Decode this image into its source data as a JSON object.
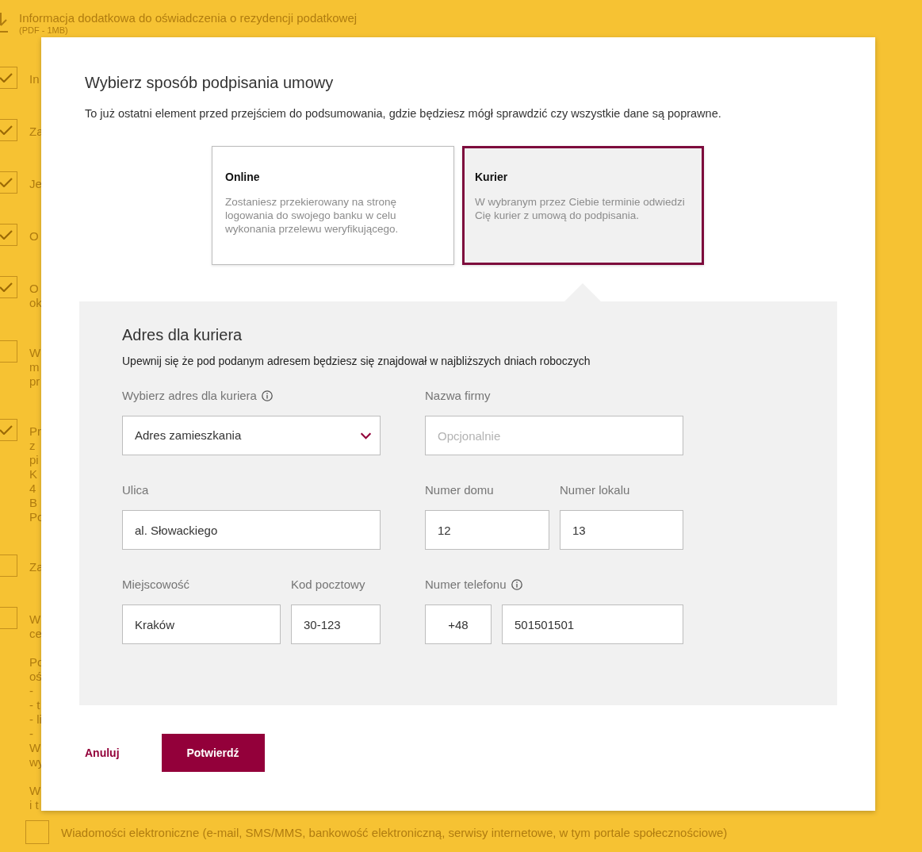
{
  "background_page": {
    "document": {
      "title": "Informacja dodatkowa do oświadczenia o rezydencji podatkowej",
      "subtitle": "(PDF - 1MB)"
    },
    "items": [
      {
        "kind": "checkbox",
        "checked": true,
        "lines": [
          "In"
        ]
      },
      {
        "kind": "checkbox",
        "checked": true,
        "lines": [
          "Za"
        ]
      },
      {
        "kind": "checkbox",
        "checked": true,
        "lines": [
          "Je"
        ]
      },
      {
        "kind": "checkbox",
        "checked": true,
        "lines": [
          "O"
        ]
      },
      {
        "kind": "checkbox",
        "checked": true,
        "lines": [
          "O",
          "ok"
        ]
      },
      {
        "kind": "checkbox",
        "checked": false,
        "lines": [
          "W",
          "m",
          "pr"
        ]
      },
      {
        "kind": "checkbox",
        "checked": true,
        "lines": [
          "Pr",
          "z",
          "pi",
          "K",
          "4",
          "B",
          "Po"
        ]
      },
      {
        "kind": "checkbox",
        "checked": false,
        "lines": [
          "Za"
        ]
      },
      {
        "kind": "checkbox",
        "checked": false,
        "lines": [
          "W",
          "ce"
        ]
      },
      {
        "kind": "text",
        "lines": [
          "Po",
          "oś",
          "-",
          "- t",
          "- li",
          "-",
          "W",
          "wy"
        ]
      },
      {
        "kind": "text",
        "lines": [
          "W",
          "i t"
        ]
      },
      {
        "kind": "subcheckbox",
        "checked": false,
        "lines": [
          "Wiadomości elektroniczne (e-mail, SMS/MMS, bankowość elektroniczną, serwisy internetowe, w tym portale społecznościowe)"
        ]
      }
    ]
  },
  "dialog": {
    "title": "Wybierz sposób podpisania umowy",
    "description": "To już ostatni element przed przejściem do podsumowania, gdzie będziesz mógł sprawdzić czy wszystkie dane są poprawne.",
    "options": [
      {
        "title": "Online",
        "description": "Zostaniesz przekierowany na stronę logowania do swojego banku w celu wykonania przelewu weryfikującego.",
        "selected": false
      },
      {
        "title": "Kurier",
        "description": "W wybranym przez Ciebie terminie odwiedzi Cię kurier z umową do podpisania.",
        "selected": true
      }
    ],
    "address_panel": {
      "title": "Adres dla kuriera",
      "note": "Upewnij się że pod podanym adresem będziesz się znajdował w najbliższych dniach roboczych",
      "rows": [
        {
          "columns": [
            {
              "fields": [
                {
                  "label": "Wybierz adres dla kuriera",
                  "info": true,
                  "inputs": [
                    {
                      "kind": "select",
                      "value": "Adres zamieszkania"
                    }
                  ]
                }
              ]
            },
            {
              "fields": [
                {
                  "label": "Nazwa firmy",
                  "info": false,
                  "inputs": [
                    {
                      "kind": "text",
                      "placeholder": "Opcjonalnie"
                    }
                  ]
                }
              ]
            }
          ]
        },
        {
          "columns": [
            {
              "fields": [
                {
                  "label": "Ulica",
                  "info": false,
                  "inputs": [
                    {
                      "kind": "text",
                      "value": "al. Słowackiego"
                    }
                  ]
                }
              ]
            },
            {
              "fields": [
                {
                  "label": "Numer domu",
                  "info": false,
                  "inputs": [
                    {
                      "kind": "text",
                      "value": "12"
                    }
                  ]
                },
                {
                  "label": "Numer lokalu",
                  "info": false,
                  "inputs": [
                    {
                      "kind": "text",
                      "value": "13"
                    }
                  ]
                }
              ]
            }
          ]
        },
        {
          "columns": [
            {
              "fields": [
                {
                  "label": "Miejscowość",
                  "info": false,
                  "inputs": [
                    {
                      "kind": "text",
                      "value": "Kraków"
                    }
                  ]
                },
                {
                  "label": "Kod pocztowy",
                  "info": false,
                  "inputs": [
                    {
                      "kind": "text",
                      "value": "30-123"
                    }
                  ]
                }
              ]
            },
            {
              "fields": [
                {
                  "label": "Numer telefonu",
                  "info": true,
                  "inputs": [
                    {
                      "kind": "prefix",
                      "value": "+48"
                    },
                    {
                      "kind": "text",
                      "value": "501501501"
                    }
                  ]
                }
              ]
            }
          ]
        }
      ]
    },
    "actions": [
      {
        "kind": "link",
        "label": "Anuluj"
      },
      {
        "kind": "primary",
        "label": "Potwierdź"
      }
    ]
  }
}
